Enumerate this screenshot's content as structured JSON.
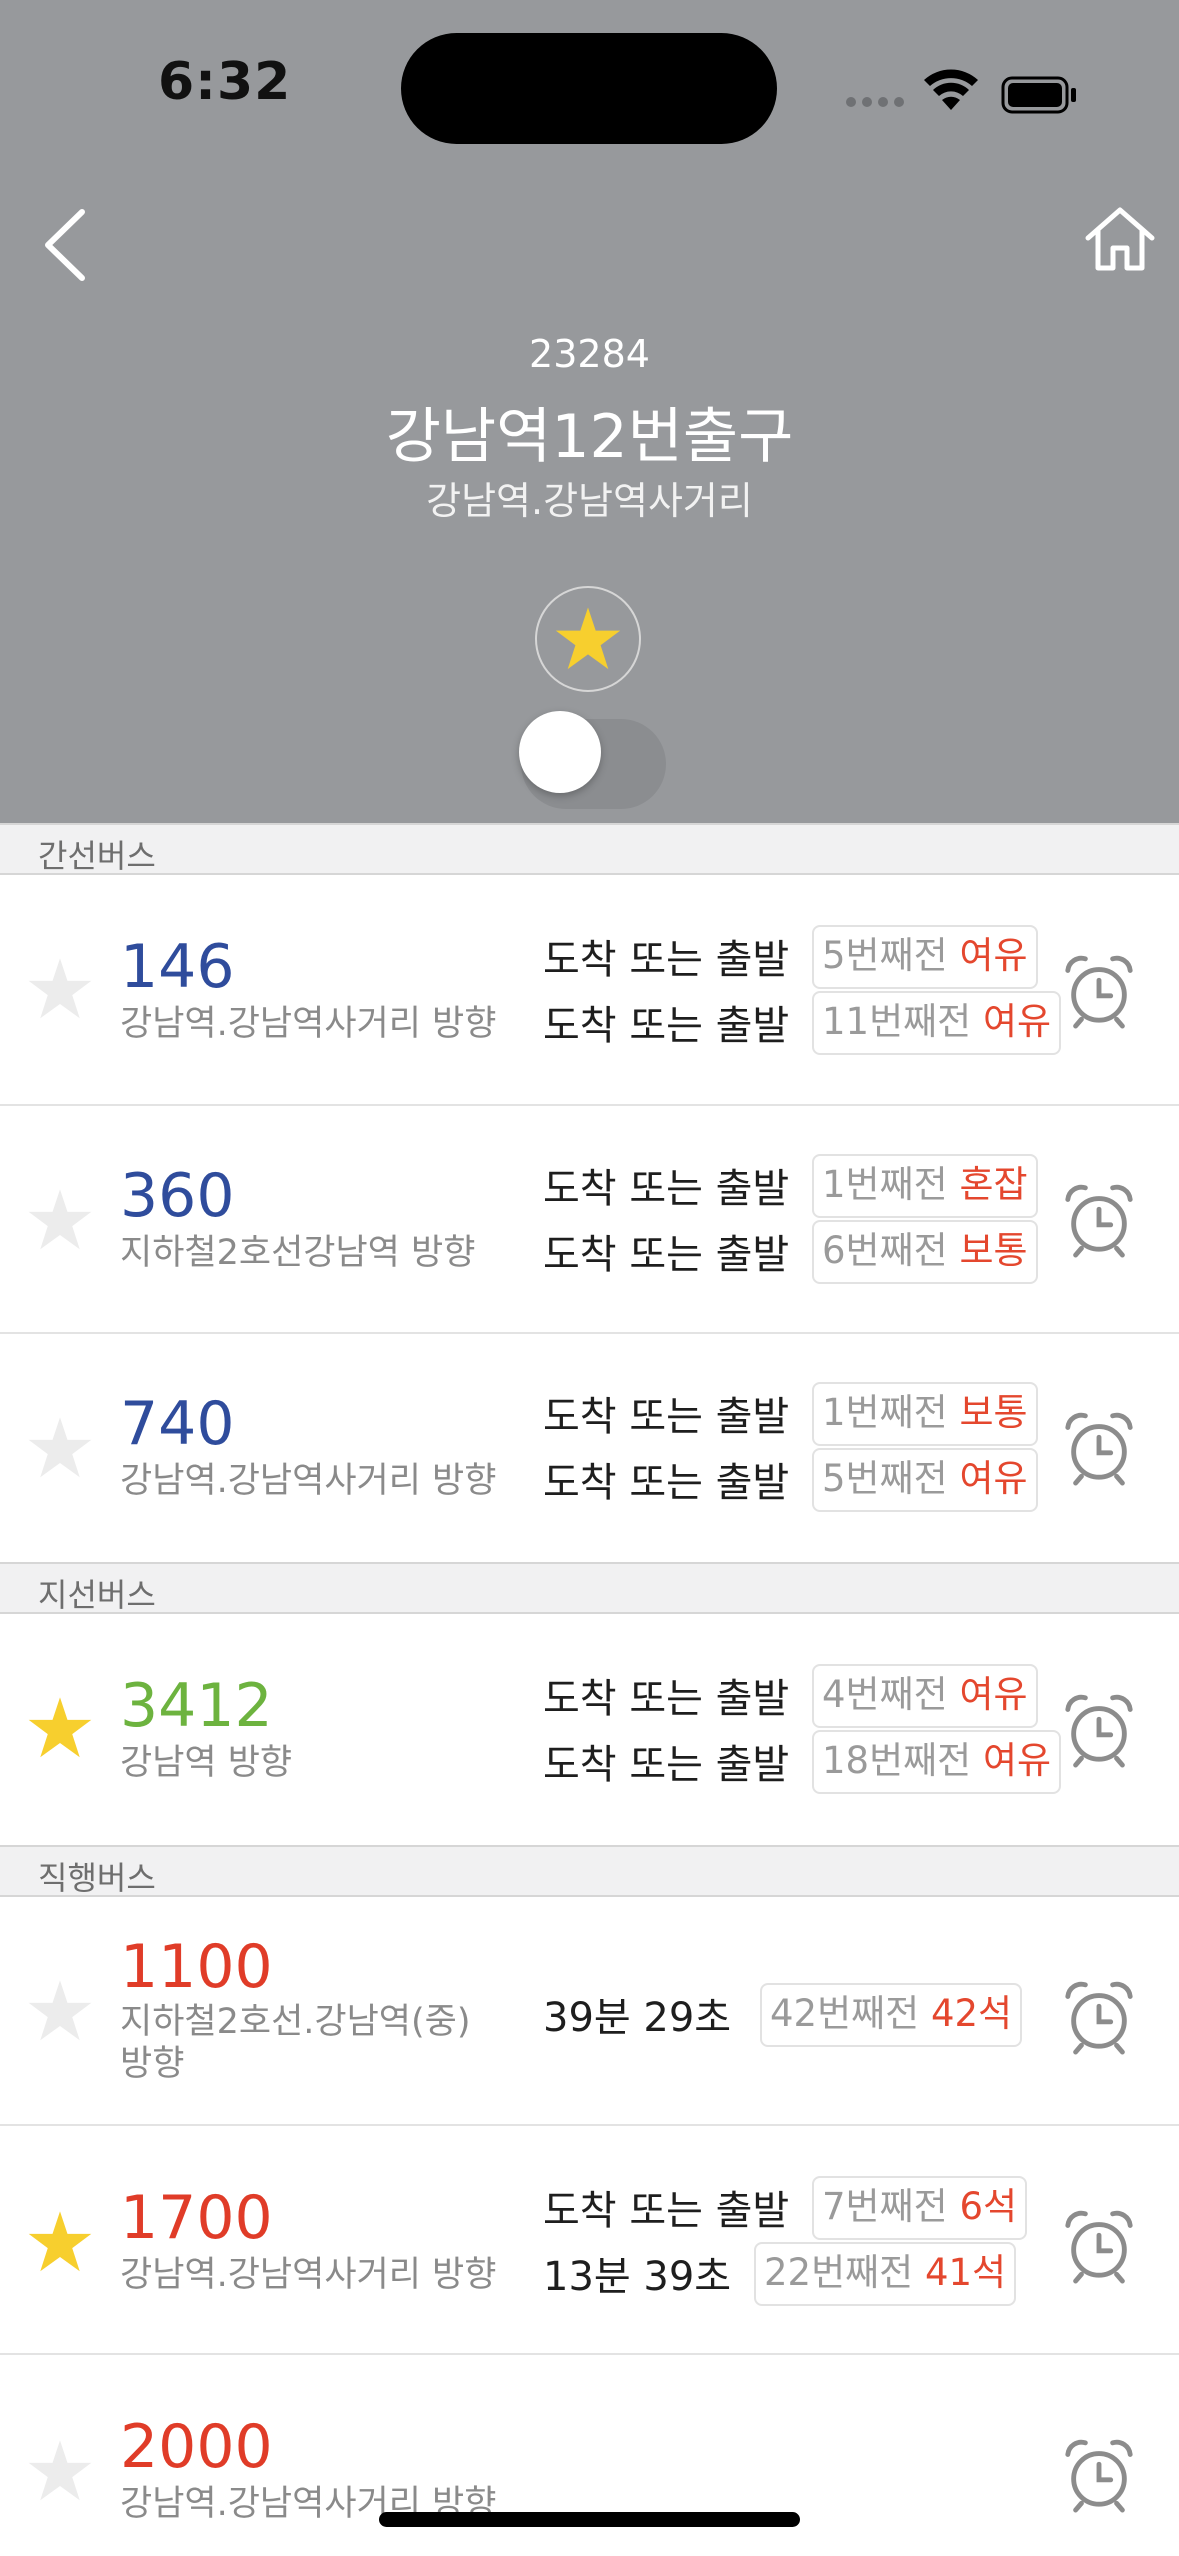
{
  "status_bar": {
    "time": "6:32"
  },
  "header": {
    "stop_id": "23284",
    "stop_name": "강남역12번출구",
    "stop_sub": "강남역.강남역사거리"
  },
  "sections": {
    "trunk": "간선버스",
    "branch": "지선버스",
    "express": "직행버스"
  },
  "routes": [
    {
      "number": "146",
      "direction": "강남역.강남역사거리 방향",
      "color": "#2f4c9c",
      "favorite": false,
      "arrivals": [
        {
          "label": "도착 또는 출발",
          "position": "5번째전",
          "status": "여유"
        },
        {
          "label": "도착 또는 출발",
          "position": "11번째전",
          "status": "여유"
        }
      ]
    },
    {
      "number": "360",
      "direction": "지하철2호선강남역 방향",
      "color": "#2f4c9c",
      "favorite": false,
      "arrivals": [
        {
          "label": "도착 또는 출발",
          "position": "1번째전",
          "status": "혼잡"
        },
        {
          "label": "도착 또는 출발",
          "position": "6번째전",
          "status": "보통"
        }
      ]
    },
    {
      "number": "740",
      "direction": "강남역.강남역사거리 방향",
      "color": "#2f4c9c",
      "favorite": false,
      "arrivals": [
        {
          "label": "도착 또는 출발",
          "position": "1번째전",
          "status": "보통"
        },
        {
          "label": "도착 또는 출발",
          "position": "5번째전",
          "status": "여유"
        }
      ]
    },
    {
      "number": "3412",
      "direction": "강남역 방향",
      "color": "#6db33f",
      "favorite": true,
      "arrivals": [
        {
          "label": "도착 또는 출발",
          "position": "4번째전",
          "status": "여유"
        },
        {
          "label": "도착 또는 출발",
          "position": "18번째전",
          "status": "여유"
        }
      ]
    },
    {
      "number": "1100",
      "direction_line1": "지하철2호선.강남역(중)",
      "direction_line2": "방향",
      "color": "#e03c28",
      "favorite": false,
      "arrivals": [
        {
          "label": "39분 29초",
          "position": "42번째전",
          "status": "42석"
        }
      ]
    },
    {
      "number": "1700",
      "direction": "강남역.강남역사거리 방향",
      "color": "#e03c28",
      "favorite": true,
      "arrivals": [
        {
          "label": "도착 또는 출발",
          "position": "7번째전",
          "status": "6석"
        },
        {
          "label": "13분 39초",
          "position": "22번째전",
          "status": "41석"
        }
      ]
    },
    {
      "number": "2000",
      "direction": "강남역.강남역사거리 방향",
      "color": "#e03c28",
      "favorite": false,
      "arrivals": []
    }
  ],
  "colors": {
    "header_bg": "#97999c",
    "favorite_on": "#f7cf2e",
    "favorite_off": "#ececec",
    "status_text": "#e4472e"
  }
}
